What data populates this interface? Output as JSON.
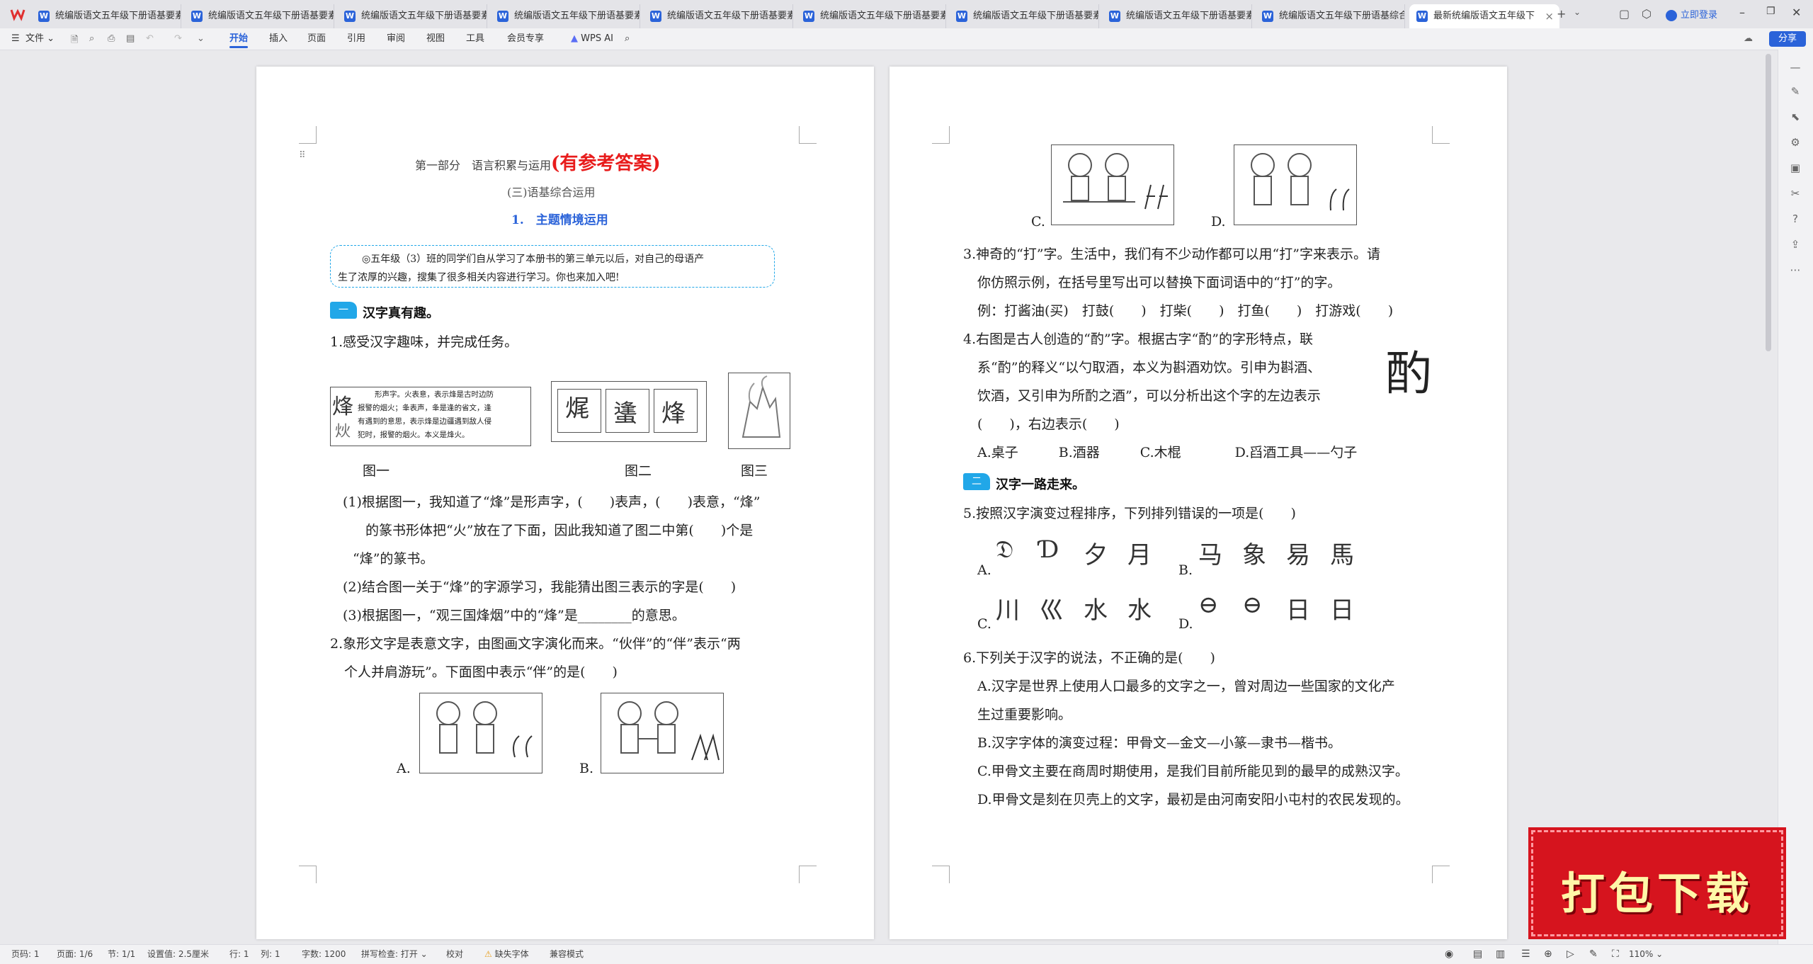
{
  "tabs": [
    {
      "label": "统编版语文五年级下册语基要素"
    },
    {
      "label": "统编版语文五年级下册语基要素"
    },
    {
      "label": "统编版语文五年级下册语基要素"
    },
    {
      "label": "统编版语文五年级下册语基要素"
    },
    {
      "label": "统编版语文五年级下册语基要素"
    },
    {
      "label": "统编版语文五年级下册语基要素"
    },
    {
      "label": "统编版语文五年级下册语基要素"
    },
    {
      "label": "统编版语文五年级下册语基要素"
    },
    {
      "label": "统编版语文五年级下册语基综合"
    },
    {
      "label": "最新统编版语文五年级下"
    }
  ],
  "tab_add": "+",
  "login_label": "立即登录",
  "menu": {
    "file": "文件",
    "items": [
      "开始",
      "插入",
      "页面",
      "引用",
      "审阅",
      "视图",
      "工具",
      "会员专享"
    ],
    "wps_ai": "WPS AI",
    "share": "分享"
  },
  "page1": {
    "header_part": "第一部分　语言积累与运用",
    "header_answer": "(有参考答案)",
    "subtitle": "(三)语基综合运用",
    "section_title": "1.　主题情境运用",
    "intro_line1": "◎五年级（3）班的同学们自从学习了本册书的第三单元以后，对自己的母语产",
    "intro_line2": "生了浓厚的兴趣，搜集了很多相关内容进行学习。你也来加入吧!",
    "sec1_icon": "一",
    "sec1_title": "汉字真有趣。",
    "q1": "1.感受汉字趣味，并完成任务。",
    "fig1_char": "烽",
    "fig1_text1": "形声字。火表意，表示烽是古时边防",
    "fig1_text2": "报警的烟火；夆表声，夆是逢的省文，逢",
    "fig1_text3": "有遇到的意思，表示烽是边疆遇到敌人侵",
    "fig1_text4": "犯时，报警的烟火。本义是烽火。",
    "fig2_chars": [
      "𤈦",
      "䗬",
      "烽"
    ],
    "fig_labels": [
      "图一",
      "图二",
      "图三"
    ],
    "q1_1a": "(1)根据图一，我知道了“烽”是形声字，(　　)表声，(　　)表意，“烽”",
    "q1_1b": "的篆书形体把“火”放在了下面，因此我知道了图二中第(　　)个是",
    "q1_1c": "“烽”的篆书。",
    "q1_2": "(2)结合图一关于“烽”的字源学习，我能猜出图三表示的字是(　　)",
    "q1_3": "(3)根据图一，“观三国烽烟”中的“烽”是________的意思。",
    "q2a": "2.象形文字是表意文字，由图画文字演化而来。“伙伴”的“伴”表示“两",
    "q2b": "个人并肩游玩”。下面图中表示“伴”的是(　　)",
    "optA": "A.",
    "optB": "B."
  },
  "page2": {
    "optC": "C.",
    "optD": "D.",
    "q3a": "3.神奇的“打”字。生活中，我们有不少动作都可以用“打”字来表示。请",
    "q3b": "你仿照示例，在括号里写出可以替换下面词语中的“打”的字。",
    "q3c": "例：打酱油(买)　打鼓(　　)　打柴(　　)　打鱼(　　)　打游戏(　　)",
    "q4a": "4.右图是古人创造的“酌”字。根据古字“酌”的字形特点，联",
    "q4b": "系“酌”的释义“以勺取酒，本义为斟酒劝饮。引申为斟酒、",
    "q4c": "饮酒，又引申为所酌之酒”，可以分析出这个字的左边表示",
    "q4d": "(　　)，右边表示(　　)",
    "q4_opts": "A.桌子　　　B.酒器　　　C.木棍　　　　D.舀酒工具——勺子",
    "sec2_icon": "二",
    "sec2_title": "汉字一路走来。",
    "q5": "5.按照汉字演变过程排序，下列排列错误的一项是(　　)",
    "q5_labels": [
      "A.",
      "B.",
      "C.",
      "D."
    ],
    "q5_glyphs_a": [
      "𝔇",
      "Ɗ",
      "夕",
      "月"
    ],
    "q5_glyphs_b": [
      "马",
      "象",
      "易",
      "馬"
    ],
    "q5_glyphs_c": [
      "川",
      "巛",
      "水",
      "水"
    ],
    "q5_glyphs_d": [
      "⊖",
      "⊖",
      "日",
      "日"
    ],
    "q6": "6.下列关于汉字的说法，不正确的是(　　)",
    "q6a1": "A.汉字是世界上使用人口最多的文字之一，曾对周边一些国家的文化产",
    "q6a2": "生过重要影响。",
    "q6b": "B.汉字字体的演变过程：甲骨文—金文—小篆—隶书—楷书。",
    "q6c": "C.甲骨文主要在商周时期使用，是我们目前所能见到的最早的成熟汉字。",
    "q6d": "D.甲骨文是刻在贝壳上的文字，最初是由河南安阳小屯村的农民发现的。",
    "zhuo_glyph": "酌"
  },
  "status": {
    "page_code": "页码: 1",
    "pages": "页面: 1/6",
    "section": "节: 1/1",
    "setting": "设置值: 2.5厘米",
    "row": "行: 1",
    "col": "列: 1",
    "word_count": "字数: 1200",
    "spell_check": "拼写检查: 打开",
    "proof": "校对",
    "missing_font": "缺失字体",
    "compat": "兼容模式",
    "zoom": "110%"
  },
  "ad": {
    "label": "打包下载"
  },
  "colors": {
    "accent": "#2b63d9",
    "answer_red": "#e81c1c",
    "section_blue": "#21a7e8",
    "ad_red": "#d6141e"
  }
}
